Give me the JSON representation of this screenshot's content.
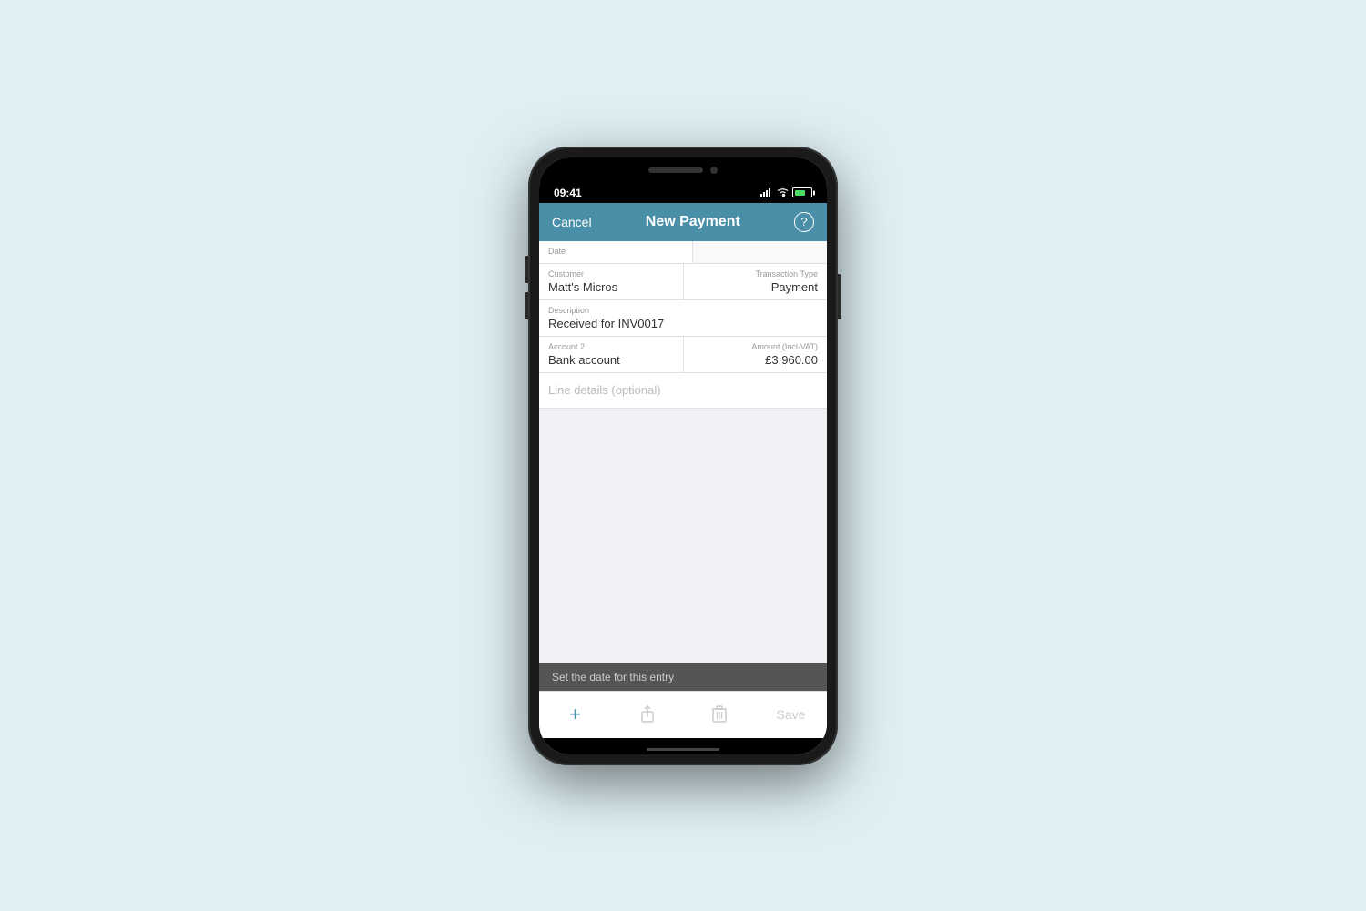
{
  "status_bar": {
    "time": "09:41",
    "battery_label": "battery"
  },
  "nav": {
    "cancel_label": "Cancel",
    "title": "New Payment",
    "help_label": "?"
  },
  "form": {
    "date_label": "Date",
    "date_value": "",
    "customer_label": "Customer",
    "customer_value": "Matt's Micros",
    "transaction_type_label": "Transaction Type",
    "transaction_type_value": "Payment",
    "description_label": "Description",
    "description_value": "Received for INV0017",
    "account2_label": "Account 2",
    "account2_value": "Bank account",
    "amount_label": "Amount (Incl-VAT)",
    "amount_value": "£3,960.00",
    "line_details_placeholder": "Line details (optional)"
  },
  "footer": {
    "hint_text": "Set the date for this entry"
  },
  "toolbar": {
    "add_label": "+",
    "share_label": "share",
    "delete_label": "delete",
    "save_label": "Save"
  }
}
